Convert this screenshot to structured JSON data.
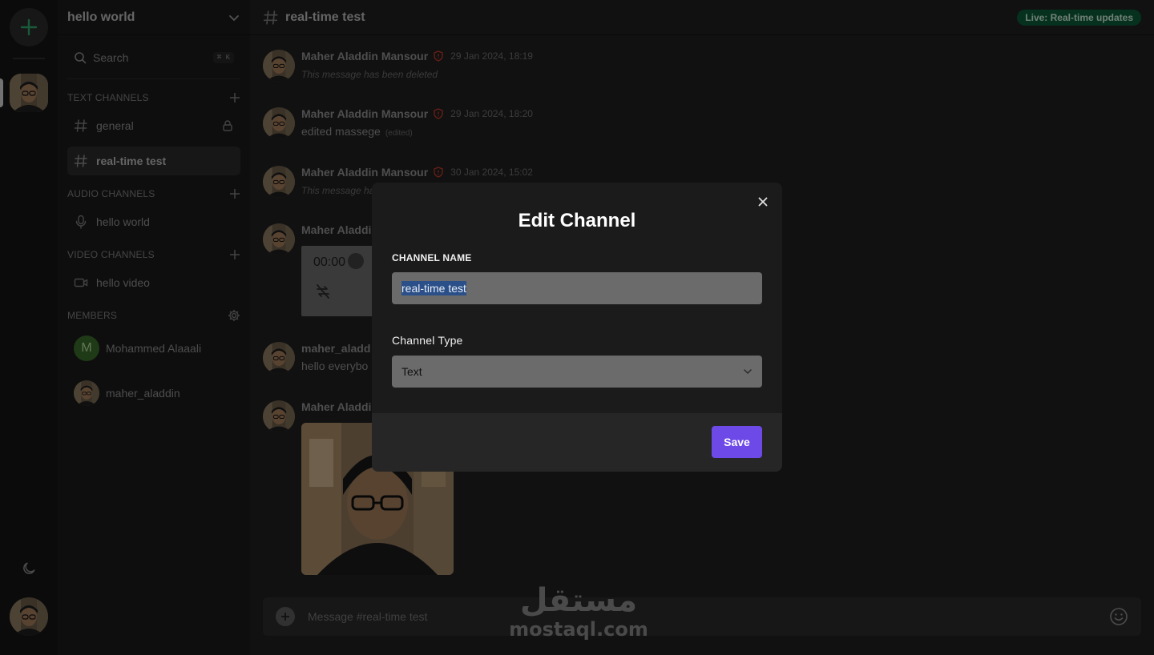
{
  "server": {
    "name": "hello world"
  },
  "search": {
    "label": "Search",
    "shortcut": "⌘ K"
  },
  "sections": {
    "text": "TEXT CHANNELS",
    "audio": "AUDIO CHANNELS",
    "video": "VIDEO CHANNELS",
    "members": "MEMBERS"
  },
  "channels": {
    "text": [
      {
        "label": "general"
      },
      {
        "label": "real-time test"
      }
    ],
    "audio": [
      {
        "label": "hello world"
      }
    ],
    "video": [
      {
        "label": "hello video"
      }
    ]
  },
  "members": [
    {
      "initial": "M",
      "name": "Mohammed Alaaali"
    },
    {
      "name": "maher_aladdin"
    }
  ],
  "topbar": {
    "title": "real-time test",
    "badge": "Live: Real-time updates"
  },
  "messages": [
    {
      "author": "Maher Aladdin Mansour",
      "time": "29 Jan 2024, 18:19",
      "body": "This message has been deleted"
    },
    {
      "author": "Maher Aladdin Mansour",
      "time": "29 Jan 2024, 18:20",
      "body": "edited massege",
      "edited": "(edited)"
    },
    {
      "author": "Maher Aladdin Mansour",
      "time": "30 Jan 2024, 15:02",
      "body": "This message ha"
    },
    {
      "author": "Maher Aladdin",
      "audio_time": "00:00"
    },
    {
      "author": "maher_aladd",
      "body": "hello everybo"
    },
    {
      "author": "Maher Aladdin"
    }
  ],
  "composer": {
    "placeholder": "Message #real-time test"
  },
  "watermark": {
    "arabic": "مستقل",
    "latin": "mostaql.com"
  },
  "modal": {
    "title": "Edit Channel",
    "name_label": "CHANNEL NAME",
    "name_value": "real-time test",
    "type_label": "Channel Type",
    "type_value": "Text",
    "save_label": "Save"
  },
  "colors": {
    "accent": "#6d4ae8",
    "live_badge": "#0c5a3a",
    "add_server": "#2fa56a"
  }
}
